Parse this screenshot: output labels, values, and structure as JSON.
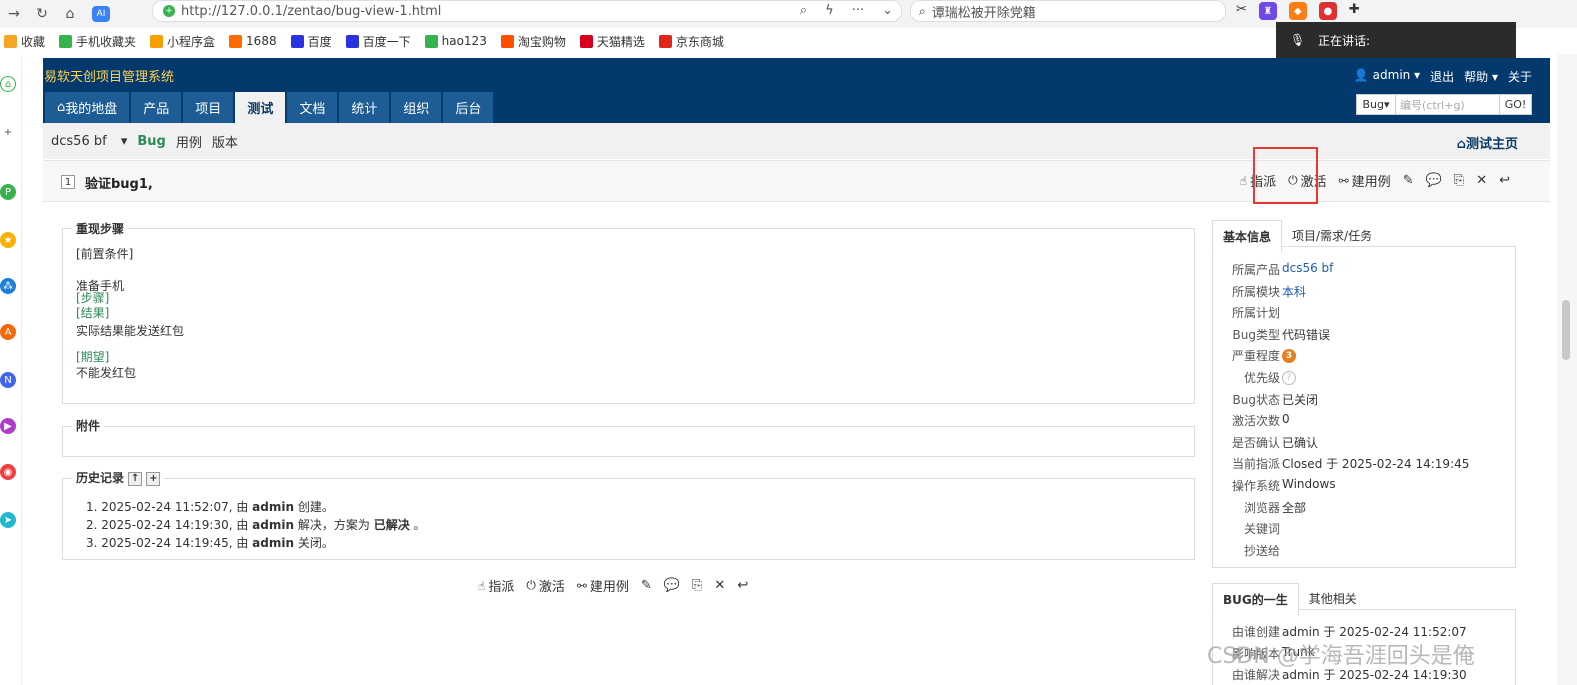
{
  "browser": {
    "url": "http://127.0.0.1/zentao/bug-view-1.html",
    "search_text": "谭瑞松被开除党籍",
    "ai_badge": "AI",
    "speaker_text": "正在讲话:"
  },
  "bookmarks": [
    {
      "label": "收藏",
      "icon": "star-icon",
      "color": "#f5a623"
    },
    {
      "label": "手机收藏夹",
      "icon": "phone-icon",
      "color": "#37b24d"
    },
    {
      "label": "小程序盒",
      "icon": "box-icon",
      "color": "#f59f00"
    },
    {
      "label": "1688",
      "icon": "ali-icon",
      "color": "#ff6a00"
    },
    {
      "label": "百度",
      "icon": "baidu-icon",
      "color": "#2932e1"
    },
    {
      "label": "百度一下",
      "icon": "baidu-icon",
      "color": "#2932e1"
    },
    {
      "label": "hao123",
      "icon": "hao123-icon",
      "color": "#37b24d"
    },
    {
      "label": "淘宝购物",
      "icon": "taobao-icon",
      "color": "#ff5000"
    },
    {
      "label": "天猫精选",
      "icon": "tmall-icon",
      "color": "#d6001c"
    },
    {
      "label": "京东商城",
      "icon": "jd-icon",
      "color": "#e1251b"
    }
  ],
  "app": {
    "title": "易软天创项目管理系统",
    "user": "admin",
    "user_menu": [
      "退出",
      "帮助",
      "关于"
    ],
    "tabs": [
      "我的地盘",
      "产品",
      "项目",
      "测试",
      "文档",
      "统计",
      "组织",
      "后台"
    ],
    "active_tab": "测试",
    "quick_search": {
      "type": "Bug",
      "placeholder": "编号(ctrl+g)",
      "go": "GO!"
    }
  },
  "subnav": {
    "product": "dcs56 bf",
    "items": [
      "Bug",
      "用例",
      "版本"
    ],
    "home": "测试主页"
  },
  "bug": {
    "id": "1",
    "title": "验证bug1,",
    "actions": [
      "指派",
      "激活",
      "建用例"
    ],
    "steps_legend": "重现步骤",
    "steps": [
      {
        "text": "[前置条件]",
        "style": "normal"
      },
      {
        "text": "准备手机",
        "style": "normal"
      },
      {
        "text": "[步骤]",
        "style": "green"
      },
      {
        "text": "[结果]",
        "style": "green"
      },
      {
        "text": "实际结果能发送红包",
        "style": "normal"
      },
      {
        "text": "[期望]",
        "style": "green"
      },
      {
        "text": "不能发红包",
        "style": "normal"
      }
    ],
    "attachments_legend": "附件",
    "history_legend": "历史记录",
    "history": [
      {
        "time": "2025-02-24 11:52:07,",
        "who": "admin",
        "action": "创建。",
        "extra": ""
      },
      {
        "time": "2025-02-24 14:19:30,",
        "who": "admin",
        "action": "解决，方案为",
        "extra": "已解决"
      },
      {
        "time": "2025-02-24 14:19:45,",
        "who": "admin",
        "action": "关闭。",
        "extra": ""
      }
    ]
  },
  "basic_info": {
    "tabs": [
      "基本信息",
      "项目/需求/任务"
    ],
    "rows": [
      {
        "label": "所属产品",
        "value": "dcs56 bf",
        "link": true
      },
      {
        "label": "所属模块",
        "value": "本科",
        "link": true
      },
      {
        "label": "所属计划",
        "value": "",
        "link": false
      },
      {
        "label": "Bug类型",
        "value": "代码错误",
        "link": false
      },
      {
        "label": "严重程度",
        "value": "3",
        "link": false
      },
      {
        "label": "优先级",
        "value": "?",
        "link": false
      },
      {
        "label": "Bug状态",
        "value": "已关闭",
        "link": false
      },
      {
        "label": "激活次数",
        "value": "0",
        "link": false
      },
      {
        "label": "是否确认",
        "value": "已确认",
        "link": false
      },
      {
        "label": "当前指派",
        "value": "Closed 于 2025-02-24 14:19:45",
        "link": false
      },
      {
        "label": "操作系统",
        "value": "Windows",
        "link": false
      },
      {
        "label": "浏览器",
        "value": "全部",
        "link": false
      },
      {
        "label": "关键词",
        "value": "",
        "link": false
      },
      {
        "label": "抄送给",
        "value": "",
        "link": false
      }
    ]
  },
  "life_info": {
    "tabs": [
      "BUG的一生",
      "其他相关"
    ],
    "rows": [
      {
        "label": "由谁创建",
        "value": "admin 于 2025-02-24 11:52:07"
      },
      {
        "label": "影响版本",
        "value": "Trunk"
      },
      {
        "label": "由谁解决",
        "value": "admin 于 2025-02-24 14:19:30"
      }
    ]
  },
  "watermark": "CSDN @学海吾涯回头是俺",
  "colors": {
    "header": "#03396c",
    "tab": "#1d5c94",
    "accent": "#e53935",
    "green": "#2e8b57"
  }
}
